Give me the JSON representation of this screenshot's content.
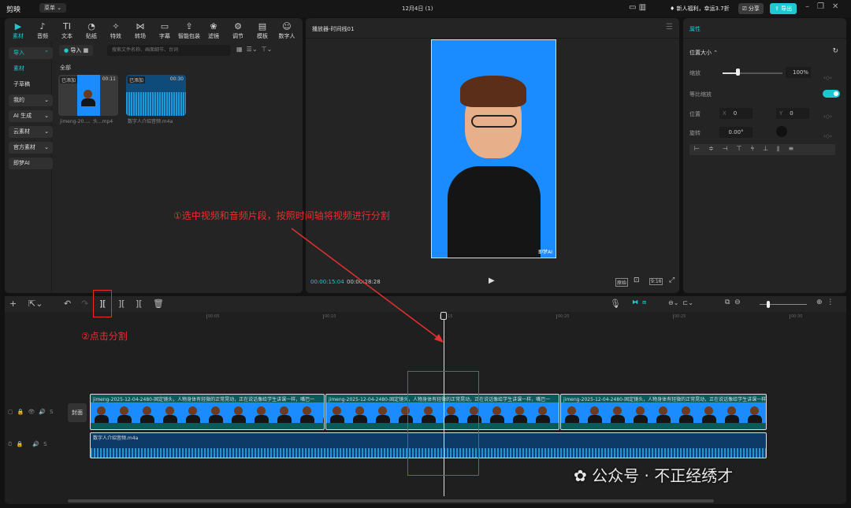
{
  "app": {
    "name": "剪映",
    "menu": "菜单",
    "title": "12月4日 (1)",
    "promo": "新人福利，幸运3.7折",
    "share": "分享",
    "export": "导出"
  },
  "toolbar": [
    {
      "icon": "media-icon",
      "glyph": "▶",
      "label": "素材"
    },
    {
      "icon": "audio-icon",
      "glyph": "♪",
      "label": "音频"
    },
    {
      "icon": "text-icon",
      "glyph": "TI",
      "label": "文本"
    },
    {
      "icon": "sticker-icon",
      "glyph": "◔",
      "label": "贴纸"
    },
    {
      "icon": "effects-icon",
      "glyph": "✧",
      "label": "特效"
    },
    {
      "icon": "transition-icon",
      "glyph": "⋈",
      "label": "转场"
    },
    {
      "icon": "subtitle-icon",
      "glyph": "▭",
      "label": "字幕"
    },
    {
      "icon": "smart-pack-icon",
      "glyph": "⇪",
      "label": "智能包装"
    },
    {
      "icon": "filter-icon",
      "glyph": "❀",
      "label": "滤镜"
    },
    {
      "icon": "adjust-icon",
      "glyph": "⚙",
      "label": "调节"
    },
    {
      "icon": "template-icon",
      "glyph": "▤",
      "label": "模板"
    },
    {
      "icon": "digital-human-icon",
      "glyph": "☺",
      "label": "数字人"
    }
  ],
  "sidebar": [
    {
      "label": "导入",
      "arrow": "⌃"
    },
    {
      "label": "素材",
      "arrow": ""
    },
    {
      "label": "子草稿",
      "arrow": ""
    },
    {
      "label": "我的",
      "arrow": "⌄"
    },
    {
      "label": "AI 生成",
      "arrow": "⌄"
    },
    {
      "label": "云素材",
      "arrow": "⌄"
    },
    {
      "label": "官方素材",
      "arrow": "⌄"
    },
    {
      "label": "即梦AI",
      "arrow": ""
    }
  ],
  "media": {
    "import": "导入",
    "search_placeholder": "搜索文件名称、画面细节、台词",
    "section": "全部",
    "items": [
      {
        "badge": "已添加",
        "duration": "00:11",
        "name": "jimeng-20...、头...mp4"
      },
      {
        "badge": "已添加",
        "duration": "00:30",
        "name": "数字人介绍音频.m4a"
      }
    ]
  },
  "player": {
    "title": "播放器-时间线01",
    "current": "00:00:15:04",
    "total": "00:00:28:28",
    "ratio": "9:16",
    "original": "原始",
    "watermark": "即梦AI"
  },
  "props": {
    "tab": "属性",
    "section": "位置大小",
    "scale_label": "缩放",
    "scale_value": "100%",
    "scale_fraction": 0.25,
    "uniform_label": "等比缩放",
    "uniform_on": true,
    "pos_label": "位置",
    "x_label": "X",
    "x": "0",
    "y_label": "Y",
    "y": "0",
    "rot_label": "旋转",
    "rot": "0.00°",
    "accent": "#1ec8d2"
  },
  "timeline": {
    "ticks": [
      "00:00",
      "00:05",
      "00:10",
      "00:15",
      "00:20",
      "00:25",
      "00:30"
    ],
    "cover": "封面",
    "video_clip": "jimeng-2025-12-04-2480-固定镜头，人物身体有轻微的正常晃动，正在说话像给学生讲课一样，嘴巴一",
    "audio_clip": "数字人介绍音频.m4a",
    "track_s": "S"
  },
  "annotations": {
    "step1": "①选中视频和音频片段，按照时间轴将视频进行分割",
    "step2": "②点击分割",
    "color": "#e53030"
  },
  "watermark": "公众号 · 不正经绣才"
}
